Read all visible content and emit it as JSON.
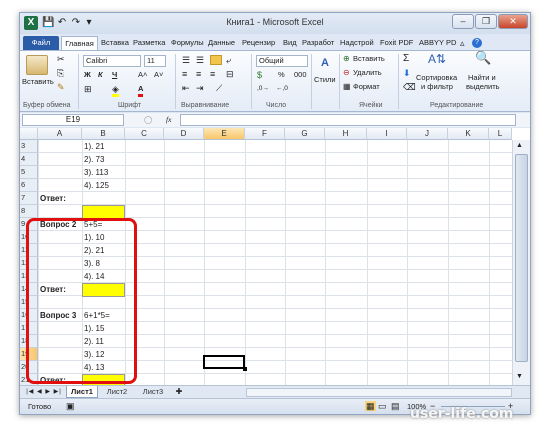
{
  "window": {
    "title": "Книга1 - Microsoft Excel",
    "controls": [
      "–",
      "❐",
      "✕"
    ]
  },
  "quick_access": [
    "💾",
    "↶",
    "↷",
    "▾"
  ],
  "ribbon_tabs": [
    "Файл",
    "Главная",
    "Вставка",
    "Разметка",
    "Формулы",
    "Данные",
    "Рецензир",
    "Вид",
    "Разработ",
    "Надстрой",
    "Foxit PDF",
    "ABBYY PD"
  ],
  "ribbon": {
    "paste_label": "Вставить",
    "clipboard_group": "Буфер обмена",
    "font_name": "Calibri",
    "font_size": "11",
    "font_group": "Шрифт",
    "align_group": "Выравнивание",
    "number_format": "Общий",
    "percent": "%",
    "thousands": "000",
    "number_group": "Число",
    "styles_label": "Стили",
    "insert_label": "Вставить",
    "delete_label": "Удалить",
    "format_label": "Формат",
    "cells_group": "Ячейки",
    "sort_label": "Сортировка",
    "sort_label2": "и фильтр",
    "find_label": "Найти и",
    "find_label2": "выделить",
    "editing_group": "Редактирование",
    "bold": "Ж",
    "italic": "К",
    "underline": "Ч",
    "grow": "A˄",
    "shrink": "A˅"
  },
  "formula_bar": {
    "name_box": "E19",
    "fx": "fx",
    "formula": ""
  },
  "columns": [
    "A",
    "B",
    "C",
    "D",
    "E",
    "F",
    "G",
    "H",
    "I",
    "J",
    "K",
    "L"
  ],
  "rows": [
    {
      "n": "3",
      "a": "",
      "b": "1). 21"
    },
    {
      "n": "4",
      "a": "",
      "b": "2). 73"
    },
    {
      "n": "5",
      "a": "",
      "b": "3). 113"
    },
    {
      "n": "6",
      "a": "",
      "b": "4). 125"
    },
    {
      "n": "7",
      "a": "Ответ:",
      "b": ""
    },
    {
      "n": "8",
      "a": "",
      "b": ""
    },
    {
      "n": "9",
      "a": "Вопрос 2",
      "b": "5+5="
    },
    {
      "n": "10",
      "a": "",
      "b": "1). 10"
    },
    {
      "n": "11",
      "a": "",
      "b": "2). 21"
    },
    {
      "n": "12",
      "a": "",
      "b": "3). 8"
    },
    {
      "n": "13",
      "a": "",
      "b": "4). 14"
    },
    {
      "n": "14",
      "a": "Ответ:",
      "b": ""
    },
    {
      "n": "15",
      "a": "",
      "b": ""
    },
    {
      "n": "16",
      "a": "Вопрос 3",
      "b": "6+1*5="
    },
    {
      "n": "17",
      "a": "",
      "b": "1). 15"
    },
    {
      "n": "18",
      "a": "",
      "b": "2). 11"
    },
    {
      "n": "19",
      "a": "",
      "b": "3). 12"
    },
    {
      "n": "20",
      "a": "",
      "b": "4). 13"
    },
    {
      "n": "21",
      "a": "Ответ:",
      "b": ""
    }
  ],
  "sheets": [
    "Лист1",
    "Лист2",
    "Лист3"
  ],
  "status": {
    "ready": "Готово",
    "zoom": "100%",
    "minus": "−",
    "plus": "+"
  },
  "watermark": "user-life.com",
  "colors": {
    "answer_fill": "#ffff00",
    "highlight": "#e01010",
    "file_tab": "#2a5ca8"
  }
}
